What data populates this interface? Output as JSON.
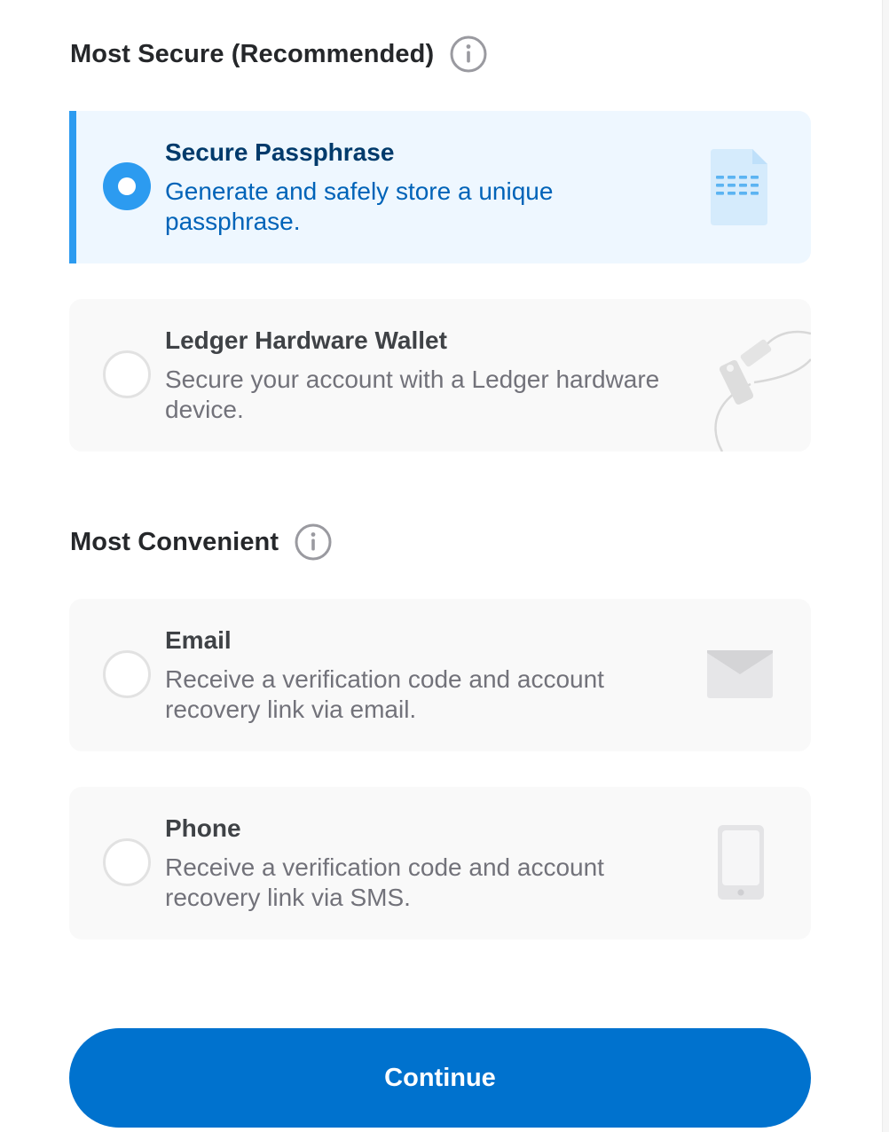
{
  "sections": {
    "secure": {
      "heading": "Most Secure (Recommended)",
      "info_icon": "info-circle-icon"
    },
    "convenient": {
      "heading": "Most Convenient",
      "info_icon": "info-circle-icon"
    }
  },
  "options": [
    {
      "title": "Secure Passphrase",
      "description": "Generate and safely store a unique passphrase.",
      "selected": true,
      "icon": "passphrase-document-icon"
    },
    {
      "title": "Ledger Hardware Wallet",
      "description": "Secure your account with a Ledger hardware device.",
      "selected": false,
      "icon": "ledger-device-icon"
    },
    {
      "title": "Email",
      "description": "Receive a verification code and account recovery link via email.",
      "selected": false,
      "icon": "envelope-icon"
    },
    {
      "title": "Phone",
      "description": "Receive a verification code and account recovery link via SMS.",
      "selected": false,
      "icon": "mobile-phone-icon"
    }
  ],
  "actions": {
    "continue_label": "Continue"
  },
  "colors": {
    "accent": "#2c9bf0",
    "primary_button": "#0072ce",
    "selected_background": "#eef7ff",
    "option_background": "#f9f9f9",
    "heading_text": "#25272a",
    "muted_text": "#72727a"
  }
}
